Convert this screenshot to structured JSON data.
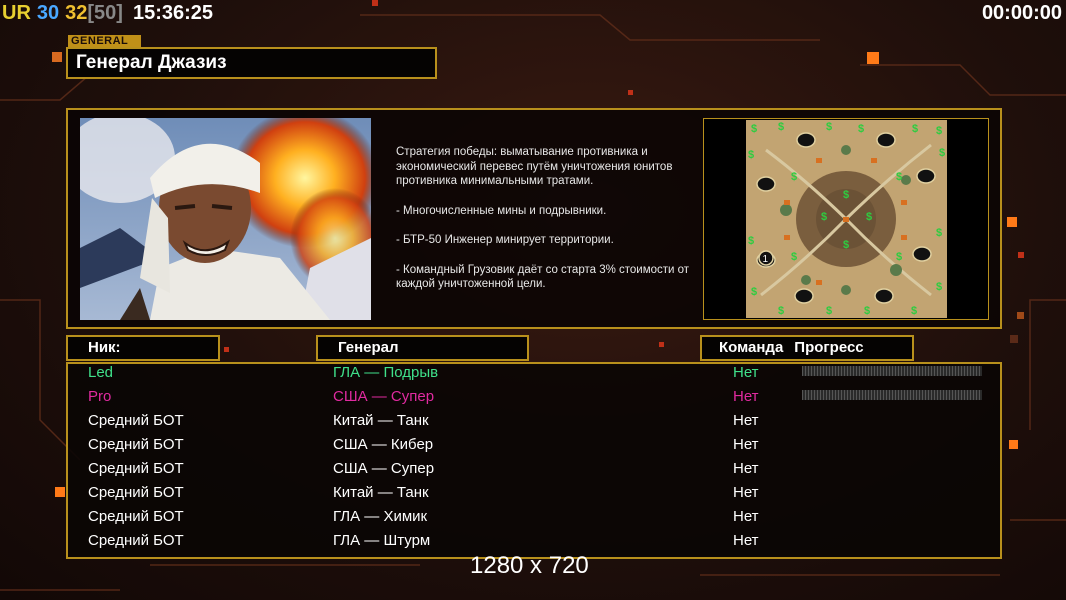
{
  "hud": {
    "ur": "UR",
    "fps1": "30",
    "fps2": "32",
    "fps_max": "[50]",
    "clock": "15:36:25",
    "timer": "00:00:00"
  },
  "general": {
    "tag": "GENERAL",
    "name": "Генерал Джазиз"
  },
  "description": [
    "Стратегия победы: выматывание противника и экономический перевес путём уничтожения юнитов противника минимальными тратами.",
    "- Многочисленные мины и подрывники.",
    "- БТР-50 Инженер минирует территории.",
    "- Командный Грузовик даёт со старта 3% стоимости от каждой уничтоженной цели."
  ],
  "headers": {
    "nick": "Ник:",
    "general": "Генерал",
    "team": "Команда",
    "progress": "Прогресс"
  },
  "players": [
    {
      "nick": "Led",
      "general": "ГЛА — Подрыв",
      "team": "Нет",
      "color": "#3fe08a",
      "progress": 0
    },
    {
      "nick": "Pro",
      "general": "США — Супер",
      "team": "Нет",
      "color": "#e02aa0",
      "progress": 0
    },
    {
      "nick": "Средний БОТ",
      "general": "Китай — Танк",
      "team": "Нет",
      "color": "#ffffff"
    },
    {
      "nick": "Средний БОТ",
      "general": "США — Кибер",
      "team": "Нет",
      "color": "#ffffff"
    },
    {
      "nick": "Средний БОТ",
      "general": "США — Супер",
      "team": "Нет",
      "color": "#ffffff"
    },
    {
      "nick": "Средний БОТ",
      "general": "Китай — Танк",
      "team": "Нет",
      "color": "#ffffff"
    },
    {
      "nick": "Средний БОТ",
      "general": "ГЛА — Химик",
      "team": "Нет",
      "color": "#ffffff"
    },
    {
      "nick": "Средний БОТ",
      "general": "ГЛА — Штурм",
      "team": "Нет",
      "color": "#ffffff"
    }
  ],
  "minimap": {
    "start_label": "1"
  },
  "resolution": "1280 x 720",
  "colors": {
    "accent": "#b8901c",
    "tag": "#c09018"
  }
}
